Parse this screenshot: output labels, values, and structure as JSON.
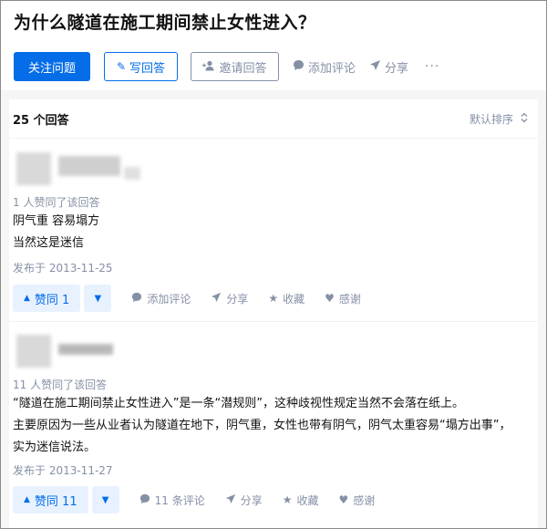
{
  "question": {
    "title": "为什么隧道在施工期间禁止女性进入？"
  },
  "actions": {
    "follow": "关注问题",
    "write": "写回答",
    "invite": "邀请回答",
    "comment": "添加评论",
    "share": "分享",
    "more": "···"
  },
  "list": {
    "count": "25 个回答",
    "sort": "默认排序"
  },
  "answers": [
    {
      "voters": "1 人赞同了该回答",
      "lines": [
        "阴气重 容易塌方",
        "当然这是迷信"
      ],
      "date": "发布于 2013-11-25",
      "vote": "赞同 1",
      "comment": "添加评论",
      "share": "分享",
      "favorite": "收藏",
      "thanks": "感谢"
    },
    {
      "voters": "11 人赞同了该回答",
      "lines": [
        "“隧道在施工期间禁止女性进入”是一条“潜规则”，这种歧视性规定当然不会落在纸上。",
        "主要原因为一些从业者认为隧道在地下，阴气重，女性也带有阴气，阴气太重容易“塌方出事”，",
        "实为迷信说法。"
      ],
      "date": "发布于 2013-11-27",
      "vote": "赞同 11",
      "comment": "11 条评论",
      "share": "分享",
      "favorite": "收藏",
      "thanks": "感谢"
    }
  ],
  "colors": {
    "accent": "#056de8",
    "muted": "#8590a6",
    "vote_bg": "#e8f2ff"
  }
}
